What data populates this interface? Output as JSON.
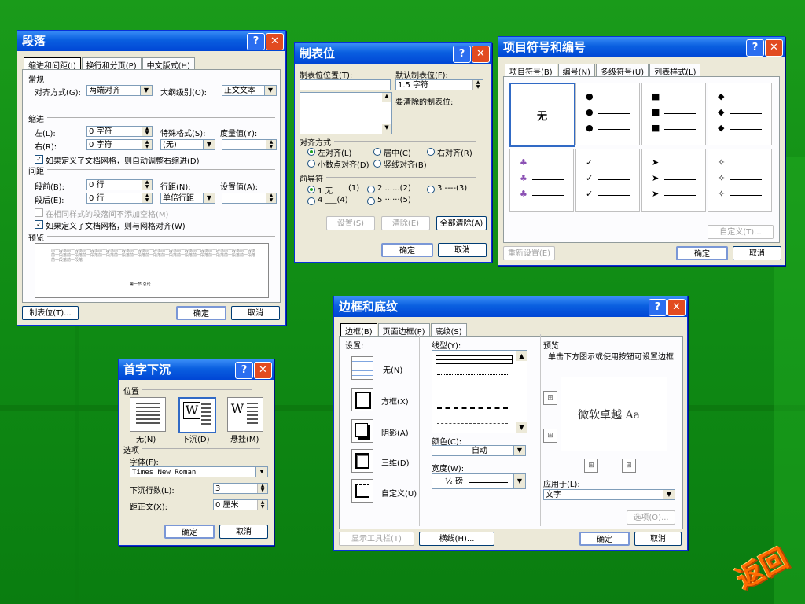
{
  "paragraph": {
    "title": "段落",
    "help": "?",
    "close": "✕",
    "tabs": [
      "缩进和间距(I)",
      "换行和分页(P)",
      "中文版式(H)"
    ],
    "general_label": "常规",
    "align_label": "对齐方式(G):",
    "align_value": "两端对齐",
    "outline_label": "大纲级别(O):",
    "outline_value": "正文文本",
    "indent_label": "缩进",
    "left_label": "左(L):",
    "left_value": "0 字符",
    "special_label": "特殊格式(S):",
    "special_value": "(无)",
    "measure_label": "度量值(Y):",
    "right_label": "右(R):",
    "right_value": "0 字符",
    "auto_indent_check": "如果定义了文档网格，则自动调整右缩进(D)",
    "spacing_label": "间距",
    "before_label": "段前(B):",
    "before_value": "0 行",
    "line_label": "行距(N):",
    "setval_label": "设置值(A):",
    "after_label": "段后(E):",
    "after_value": "0 行",
    "line_value": "单倍行距",
    "no_space_check": "在相同样式的段落间不添加空格(M)",
    "grid_align_check": "如果定义了文档网格，则与网格对齐(W)",
    "preview_label": "预览",
    "preview_text": "前一段落前一段落前一段落前一段落前一段落前一段落前一段落前一段落前一段落前一段落前一段落前一段落前一段落前一段落前一段落前一段落前一段落前一段落前一段落前一段落前一段落前一段落前一段落前一段落前一段落前一段落前一段落前一段落",
    "preview_center": "第一节  总论",
    "tab_button": "制表位(T)...",
    "ok": "确定",
    "cancel": "取消"
  },
  "tabstops": {
    "title": "制表位",
    "help": "?",
    "close": "✕",
    "position_label": "制表位位置(T):",
    "default_label": "默认制表位(F):",
    "default_value": "1.5 字符",
    "clear_label": "要清除的制表位:",
    "align_label": "对齐方式",
    "align_left": "左对齐(L)",
    "align_center": "居中(C)",
    "align_right": "右对齐(R)",
    "align_decimal": "小数点对齐(D)",
    "align_bar": "竖线对齐(B)",
    "leader_label": "前导符",
    "leader1": "1 无",
    "leader1_key": "(1)",
    "leader2": "2 ......(2)",
    "leader3": "3 ----(3)",
    "leader4": "4 ___(4)",
    "leader5": "5 ······(5)",
    "set_btn": "设置(S)",
    "clear_btn": "清除(E)",
    "clear_all_btn": "全部清除(A)",
    "ok": "确定",
    "cancel": "取消"
  },
  "bullets": {
    "title": "项目符号和编号",
    "help": "?",
    "close": "✕",
    "tabs": [
      "项目符号(B)",
      "编号(N)",
      "多级符号(U)",
      "列表样式(L)"
    ],
    "none_label": "无",
    "symbols": [
      "●",
      "■",
      "◆",
      "♣",
      "✓",
      "➤",
      "✧"
    ],
    "custom_btn": "自定义(T)...",
    "reset_btn": "重新设置(E)",
    "ok": "确定",
    "cancel": "取消"
  },
  "dropcap": {
    "title": "首字下沉",
    "help": "?",
    "close": "✕",
    "position_label": "位置",
    "none": "无(N)",
    "dropped": "下沉(D)",
    "margin": "悬挂(M)",
    "letter": "W",
    "options_label": "选项",
    "font_label": "字体(F):",
    "font_value": "Times New Roman",
    "lines_label": "下沉行数(L):",
    "lines_value": "3",
    "distance_label": "距正文(X):",
    "distance_value": "0 厘米",
    "ok": "确定",
    "cancel": "取消"
  },
  "borders": {
    "title": "边框和底纹",
    "help": "?",
    "close": "✕",
    "tabs": [
      "边框(B)",
      "页面边框(P)",
      "底纹(S)"
    ],
    "setting_label": "设置:",
    "settings": [
      "无(N)",
      "方框(X)",
      "阴影(A)",
      "三维(D)",
      "自定义(U)"
    ],
    "style_label": "线型(Y):",
    "color_label": "颜色(C):",
    "color_value": "自动",
    "width_label": "宽度(W):",
    "width_value": "½ 磅",
    "preview_label": "预览",
    "preview_hint": "单击下方图示或使用按钮可设置边框",
    "preview_text": "微软卓越 Aa",
    "apply_label": "应用于(L):",
    "apply_value": "文字",
    "options_btn": "选项(O)...",
    "toolbar_btn": "显示工具栏(T)",
    "hline_btn": "横线(H)...",
    "ok": "确定",
    "cancel": "取消"
  },
  "return_label": "返回"
}
